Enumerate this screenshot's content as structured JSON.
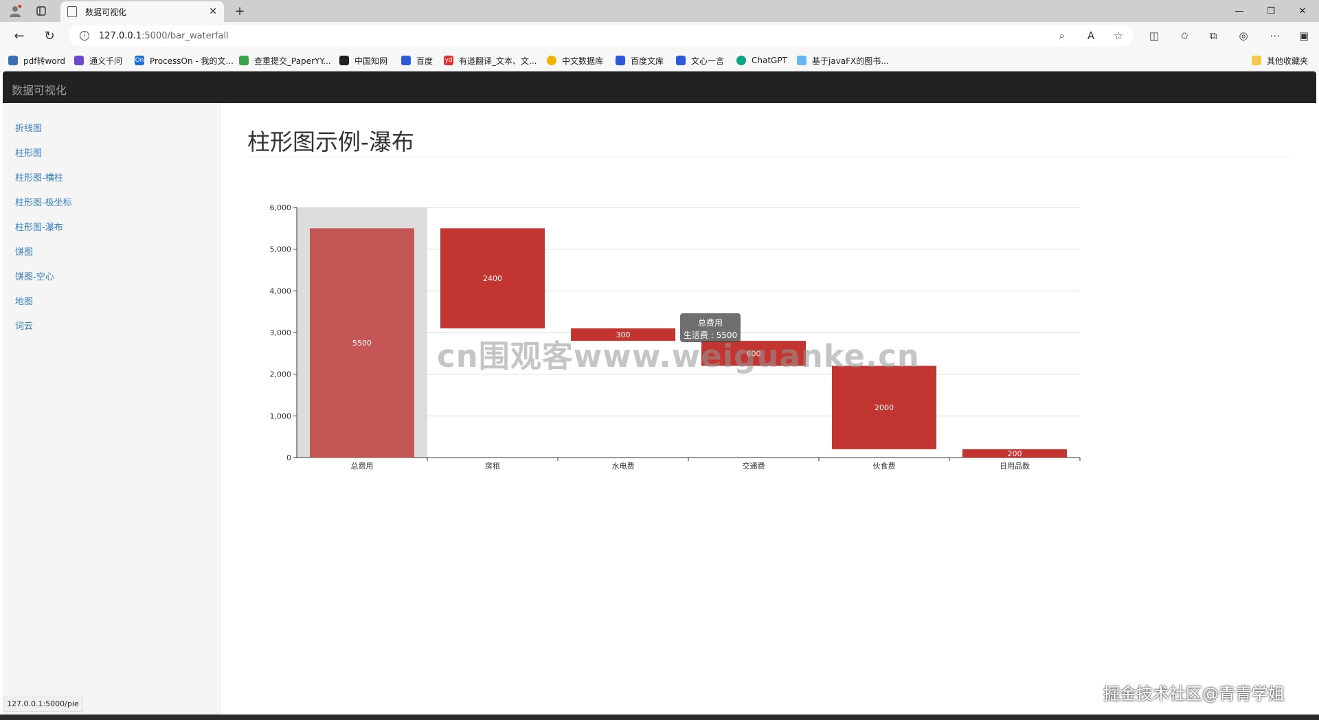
{
  "browser": {
    "tab_title": "数据可视化",
    "url_host": "127.0.0.1",
    "url_path": ":5000/bar_waterfall",
    "bookmarks": [
      {
        "label": "pdf转word",
        "color": "#3b6fb5"
      },
      {
        "label": "通义千问",
        "color": "#6a4bd0"
      },
      {
        "label": "ProcessOn - 我的文...",
        "color": "#1e6fd9",
        "icon_text": "On"
      },
      {
        "label": "查重提交_PaperYY...",
        "color": "#3aa34a"
      },
      {
        "label": "中国知网",
        "color": "#222222"
      },
      {
        "label": "百度",
        "color": "#2d5bd8"
      },
      {
        "label": "有道翻译_文本、文...",
        "color": "#d9332e",
        "icon_text": "yd"
      },
      {
        "label": "中文数据库",
        "color": "#f0b400"
      },
      {
        "label": "百度文库",
        "color": "#2d5bd8"
      },
      {
        "label": "文心一言",
        "color": "#2d5bd8"
      },
      {
        "label": "ChatGPT",
        "color": "#10a37f"
      },
      {
        "label": "基于javaFX的图书...",
        "color": "#64b5f6"
      }
    ],
    "bookmarks_folder": "其他收藏夹",
    "status_url": "127.0.0.1:5000/pie"
  },
  "app": {
    "brand": "数据可视化",
    "nav": [
      "折线图",
      "柱形图",
      "柱形图-横柱",
      "柱形图-极坐标",
      "柱形图-瀑布",
      "饼图",
      "饼图-空心",
      "地图",
      "词云"
    ],
    "page_title": "柱形图示例-瀑布"
  },
  "tooltip": {
    "title": "总费用",
    "line": "生活费 : 5500"
  },
  "overlay": {
    "watermark": "cn围观客www.weiguanke.cn",
    "credit": "掘金技术社区@青青学姐"
  },
  "chart_data": {
    "type": "bar",
    "subtype": "waterfall",
    "categories": [
      "总费用",
      "房租",
      "水电费",
      "交通费",
      "伙食费",
      "日用品数"
    ],
    "series": [
      {
        "name": "生活费",
        "values": [
          5500,
          2400,
          300,
          600,
          2000,
          200
        ]
      }
    ],
    "base": [
      0,
      3100,
      2800,
      2200,
      200,
      0
    ],
    "data_labels": [
      "5500",
      "2400",
      "300",
      "600",
      "2000",
      "200"
    ],
    "ylim": [
      0,
      6000
    ],
    "yticks": [
      "0",
      "1,000",
      "2,000",
      "3,000",
      "4,000",
      "5,000",
      "6,000"
    ],
    "grid": true,
    "highlighted_category": "总费用",
    "bar_color": "#c23531",
    "highlight_color": "#c45656",
    "hover_band_color": "#dcdcdc"
  }
}
